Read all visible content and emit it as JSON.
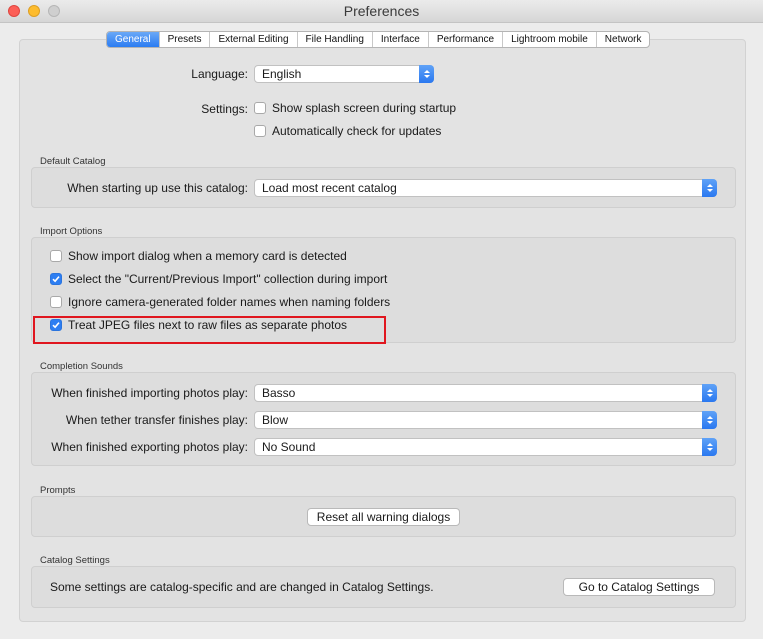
{
  "window": {
    "title": "Preferences"
  },
  "tabs": [
    "General",
    "Presets",
    "External Editing",
    "File Handling",
    "Interface",
    "Performance",
    "Lightroom mobile",
    "Network"
  ],
  "general": {
    "language_label": "Language:",
    "language_value": "English",
    "settings_label": "Settings:",
    "settings_options": [
      {
        "label": "Show splash screen during startup",
        "checked": false
      },
      {
        "label": "Automatically check for updates",
        "checked": false
      }
    ]
  },
  "default_catalog": {
    "title": "Default Catalog",
    "label": "When starting up use this catalog:",
    "value": "Load most recent catalog"
  },
  "import_options": {
    "title": "Import Options",
    "items": [
      {
        "label": "Show import dialog when a memory card is detected",
        "checked": false
      },
      {
        "label": "Select the \"Current/Previous Import\" collection during import",
        "checked": true
      },
      {
        "label": "Ignore camera-generated folder names when naming folders",
        "checked": false
      },
      {
        "label": "Treat JPEG files next to raw files as separate photos",
        "checked": true
      }
    ]
  },
  "completion_sounds": {
    "title": "Completion Sounds",
    "rows": [
      {
        "label": "When finished importing photos play:",
        "value": "Basso"
      },
      {
        "label": "When tether transfer finishes play:",
        "value": "Blow"
      },
      {
        "label": "When finished exporting photos play:",
        "value": "No Sound"
      }
    ]
  },
  "prompts": {
    "title": "Prompts",
    "reset_button": "Reset all warning dialogs"
  },
  "catalog_settings": {
    "title": "Catalog Settings",
    "text": "Some settings are catalog-specific and are changed in Catalog Settings.",
    "button": "Go to Catalog Settings"
  },
  "colors": {
    "accent": "#2d7ef2",
    "highlight": "#e0161f"
  },
  "icons": [
    "close-icon",
    "minimize-icon",
    "zoom-icon",
    "checkmark-icon",
    "select-arrows-icon"
  ]
}
